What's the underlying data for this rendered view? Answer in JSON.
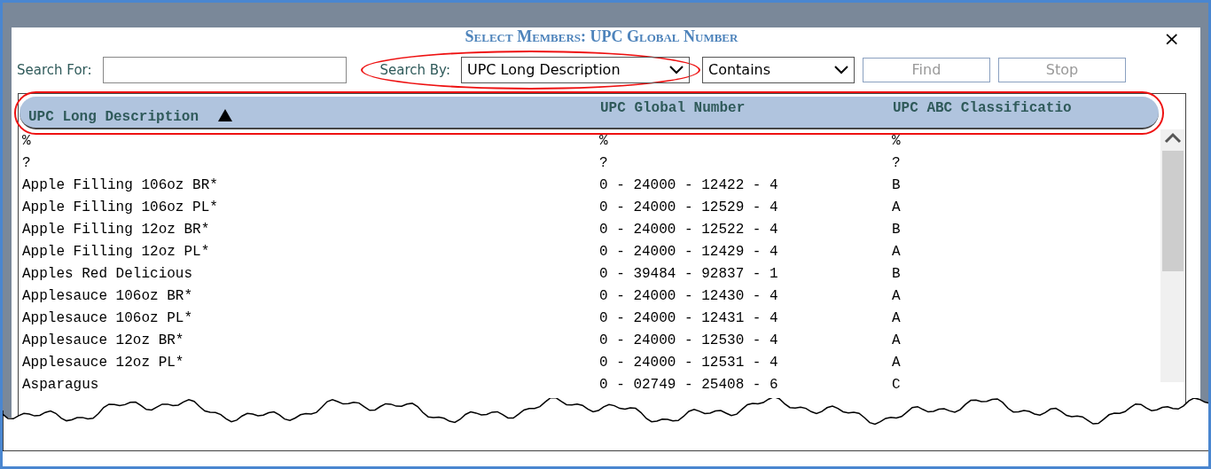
{
  "dialog": {
    "title": "Select Members: UPC Global Number",
    "close": "×"
  },
  "search": {
    "label": "Search For:",
    "by_label": "Search By:",
    "by_value": "UPC Long Description",
    "by_highlighted": true,
    "match": "Contains",
    "find": "Find",
    "stop": "Stop",
    "find_disabled": true,
    "stop_disabled": true
  },
  "table": {
    "header_highlighted": true,
    "columns": [
      {
        "label": "UPC Long Description",
        "sorted": true
      },
      {
        "label": "UPC Global Number",
        "sorted": false
      },
      {
        "label": "UPC ABC Classificatio",
        "sorted": false
      }
    ],
    "rows": [
      [
        "%",
        "%",
        "%"
      ],
      [
        "?",
        "?",
        "?"
      ],
      [
        "Apple Filling 106oz BR*",
        "0 - 24000 - 12422 - 4",
        "B"
      ],
      [
        "Apple Filling 106oz PL*",
        "0 - 24000 - 12529 - 4",
        "A"
      ],
      [
        "Apple Filling 12oz BR*",
        "0 - 24000 - 12522 - 4",
        "B"
      ],
      [
        "Apple Filling 12oz PL*",
        "0 - 24000 - 12429 - 4",
        "A"
      ],
      [
        "Apples Red Delicious",
        "0 - 39484 - 92837 - 1",
        "B"
      ],
      [
        "Applesauce 106oz BR*",
        "0 - 24000 - 12430 - 4",
        "A"
      ],
      [
        "Applesauce 106oz PL*",
        "0 - 24000 - 12431 - 4",
        "A"
      ],
      [
        "Applesauce 12oz BR*",
        "0 - 24000 - 12530 - 4",
        "A"
      ],
      [
        "Applesauce 12oz PL*",
        "0 - 24000 - 12531 - 4",
        "A"
      ],
      [
        "Asparagus",
        "0 - 02749 - 25408 - 6",
        "C"
      ]
    ]
  }
}
